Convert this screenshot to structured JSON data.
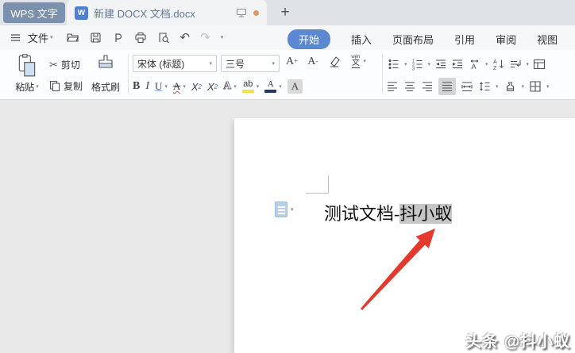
{
  "titlebar": {
    "app_tab_label": "WPS 文字",
    "doc_tab_label": "新建 DOCX 文档.docx",
    "doc_icon_letter": "W",
    "new_tab_glyph": "+"
  },
  "menubar": {
    "file_label": "文件"
  },
  "ribbon_tabs": [
    {
      "id": "home",
      "label": "开始",
      "active": true
    },
    {
      "id": "insert",
      "label": "插入",
      "active": false
    },
    {
      "id": "page-layout",
      "label": "页面布局",
      "active": false
    },
    {
      "id": "references",
      "label": "引用",
      "active": false
    },
    {
      "id": "review",
      "label": "审阅",
      "active": false
    },
    {
      "id": "view",
      "label": "视图",
      "active": false
    }
  ],
  "clipboard_group": {
    "paste_label": "粘贴",
    "cut_label": "剪切",
    "copy_label": "复制",
    "format_painter_label": "格式刷"
  },
  "font_group": {
    "font_name_value": "宋体 (标题)",
    "font_size_value": "三号",
    "grow_letter": "A",
    "grow_sign": "+",
    "shrink_letter": "A",
    "shrink_sign": "-",
    "phonetic_top": "wén",
    "phonetic_bottom": "文",
    "bold_letter": "B",
    "italic_letter": "I",
    "underline_letter": "U",
    "strike_letter": "A",
    "sup_base": "X",
    "sup_mark": "2",
    "sub_base": "X",
    "sub_mark": "2",
    "effects_letter": "A",
    "highlight_text": "ab",
    "color_letter": "A",
    "shading_letter": "A"
  },
  "paragraph_group": {
    "sort_a": "A",
    "sort_z": "Z",
    "scale_letter": "A"
  },
  "document": {
    "text_before": "测试文档-",
    "text_selected": "抖小蚁"
  },
  "watermark_text": "头条 @抖小蚁",
  "icons": {
    "caret": "▾",
    "scissors": "✂",
    "undo": "↶",
    "redo": "↷"
  },
  "colors": {
    "accent_blue": "#5b88d1",
    "wps_tab_blue_gray": "#7b90ac",
    "selection_gray": "#c6c6c6",
    "arrow_red": "#e23b2e",
    "highlight_yellow": "#f0e24a",
    "font_color_swatch": "#1f3864",
    "unsaved_dot_orange": "#e2995f"
  }
}
